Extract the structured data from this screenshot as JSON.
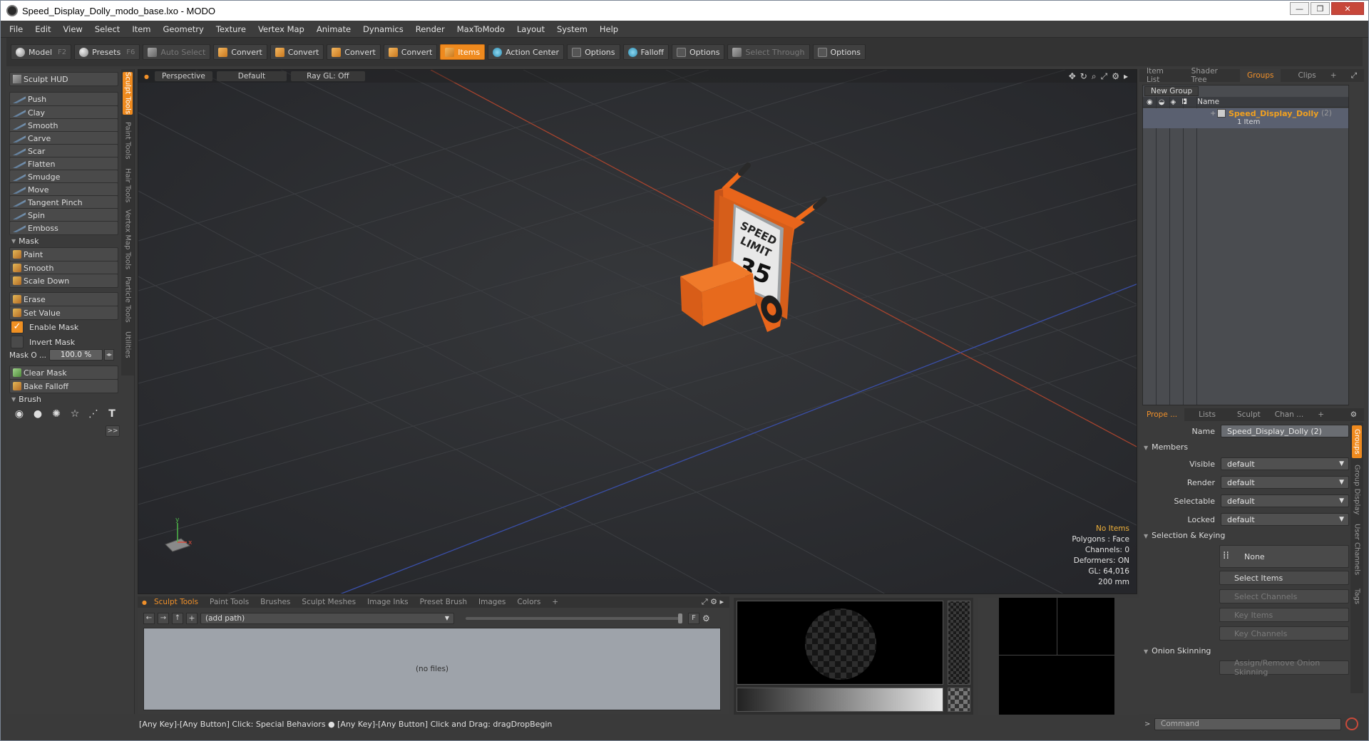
{
  "window": {
    "title": "Speed_Display_Dolly_modo_base.lxo - MODO"
  },
  "menu": [
    "File",
    "Edit",
    "View",
    "Select",
    "Item",
    "Geometry",
    "Texture",
    "Vertex Map",
    "Animate",
    "Dynamics",
    "Render",
    "MaxToModo",
    "Layout",
    "System",
    "Help"
  ],
  "toolbar": {
    "model": "Model",
    "model_key": "F2",
    "presets": "Presets",
    "presets_key": "F6",
    "auto_select": "Auto Select",
    "convert1": "Convert",
    "convert2": "Convert",
    "convert3": "Convert",
    "convert4": "Convert",
    "items": "Items",
    "action_center": "Action Center",
    "options1": "Options",
    "falloff": "Falloff",
    "options2": "Options",
    "select_through": "Select Through",
    "options3": "Options"
  },
  "left": {
    "hud": "Sculpt HUD",
    "tools": [
      "Push",
      "Clay",
      "Smooth",
      "Carve",
      "Scar",
      "Flatten",
      "Smudge",
      "Move",
      "Tangent Pinch",
      "Spin",
      "Emboss"
    ],
    "mask_header": "Mask",
    "mask_tools": [
      "Paint",
      "Smooth",
      "Scale Down"
    ],
    "erase": "Erase",
    "set_value": "Set Value",
    "enable_mask": "Enable Mask",
    "invert_mask": "Invert Mask",
    "mask_opacity_label": "Mask O ...",
    "mask_opacity_value": "100.0 %",
    "clear_mask": "Clear Mask",
    "bake_falloff": "Bake Falloff",
    "brush_header": "Brush",
    "more": ">>",
    "vtabs": [
      "Sculpt Tools",
      "Paint Tools",
      "Hair Tools",
      "Vertex Map Tools",
      "Particle Tools",
      "Utilities"
    ]
  },
  "viewport": {
    "tabs": [
      "Perspective",
      "Default",
      "Ray GL: Off"
    ],
    "info": {
      "warn": "No Items",
      "polygons": "Polygons : Face",
      "channels": "Channels: 0",
      "deformers": "Deformers: ON",
      "gl": "GL: 64,016",
      "scale": "200 mm"
    },
    "sign_top": "SPEED",
    "sign_mid": "LIMIT",
    "sign_num": "35"
  },
  "right": {
    "tabs": [
      "Item List",
      "Shader Tree",
      "Groups",
      "Clips",
      "+"
    ],
    "new_group": "New Group",
    "name_col": "Name",
    "group_name": "Speed_Display_Dolly",
    "group_count": "(2)",
    "group_sub": "1 Item",
    "prop_tabs": [
      "Prope ...",
      "Lists",
      "Sculpt",
      "Chan ...",
      "+"
    ],
    "name_label": "Name",
    "name_value": "Speed_Display_Dolly (2)",
    "members": "Members",
    "visible_label": "Visible",
    "visible_value": "default",
    "render_label": "Render",
    "render_value": "default",
    "selectable_label": "Selectable",
    "selectable_value": "default",
    "locked_label": "Locked",
    "locked_value": "default",
    "sel_keying": "Selection & Keying",
    "none": "None",
    "select_items": "Select Items",
    "select_channels": "Select Channels",
    "key_items": "Key Items",
    "key_channels": "Key Channels",
    "onion": "Onion Skinning",
    "assign_remove": "Assign/Remove Onion Skinning",
    "side_tabs": [
      "Groups",
      "Group Display",
      "User Channels",
      "Tags"
    ]
  },
  "bottom": {
    "tabs": [
      "Sculpt Tools",
      "Paint Tools",
      "Brushes",
      "Sculpt Meshes",
      "Image Inks",
      "Preset Brush",
      "Images",
      "Colors",
      "+"
    ],
    "path": "(add path)",
    "no_files": "(no files)",
    "filter": "F"
  },
  "status": {
    "text": "[Any Key]-[Any Button] Click: Special Behaviors ● [Any Key]-[Any Button] Click and Drag: dragDropBegin",
    "command_placeholder": "Command"
  }
}
